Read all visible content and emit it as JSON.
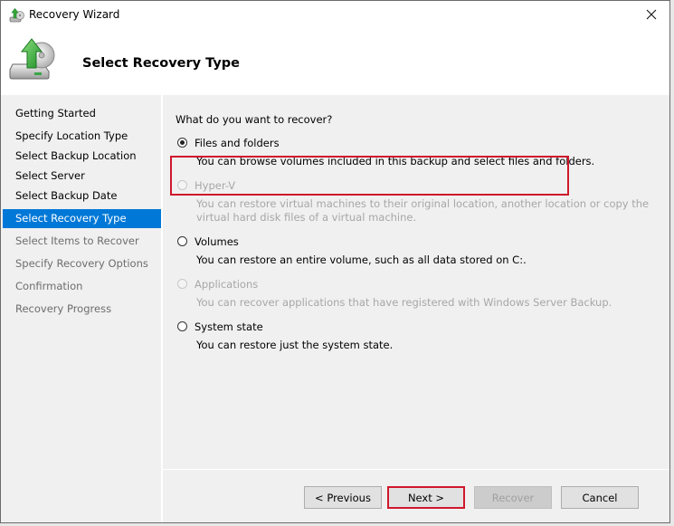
{
  "window": {
    "title": "Recovery Wizard",
    "close_icon": "close-icon"
  },
  "header": {
    "title": "Select Recovery Type",
    "icon": "backup-disk-restore-icon"
  },
  "nav": {
    "items": [
      {
        "label": "Getting Started",
        "state": "done"
      },
      {
        "label": "Specify Location Type",
        "state": "done"
      },
      {
        "label": "Select Backup Location",
        "state": "done"
      },
      {
        "label": "Select Server",
        "state": "done"
      },
      {
        "label": "Select Backup Date",
        "state": "done"
      },
      {
        "label": "Select Recovery Type",
        "state": "active"
      },
      {
        "label": "Select Items to Recover",
        "state": "pending"
      },
      {
        "label": "Specify Recovery Options",
        "state": "pending"
      },
      {
        "label": "Confirmation",
        "state": "pending"
      },
      {
        "label": "Recovery Progress",
        "state": "pending"
      }
    ]
  },
  "content": {
    "question": "What do you want to recover?",
    "options": [
      {
        "label": "Files and folders",
        "description": "You can browse volumes included in this backup and select files and folders.",
        "selected": true,
        "enabled": true
      },
      {
        "label": "Hyper-V",
        "description": "You can restore virtual machines to their original location, another location or copy the virtual hard disk files of a virtual machine.",
        "selected": false,
        "enabled": false
      },
      {
        "label": "Volumes",
        "description": "You can restore an entire volume, such as all data stored on C:.",
        "selected": false,
        "enabled": true
      },
      {
        "label": "Applications",
        "description": "You can recover applications that have registered with Windows Server Backup.",
        "selected": false,
        "enabled": false
      },
      {
        "label": "System state",
        "description": "You can restore just the system state.",
        "selected": false,
        "enabled": true
      }
    ],
    "highlight_color": "#d0172c"
  },
  "buttons": {
    "previous": "< Previous",
    "next": "Next >",
    "recover": "Recover",
    "cancel": "Cancel"
  },
  "colors": {
    "accent": "#0078d7",
    "annotation_red": "#d0172c"
  }
}
